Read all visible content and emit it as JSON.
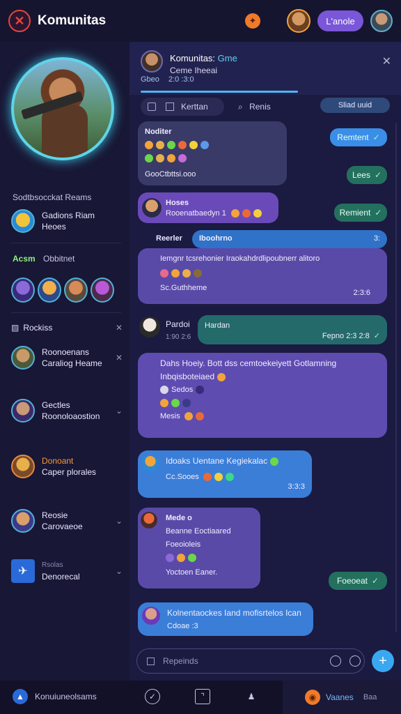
{
  "topbar": {
    "title": "Komunitas",
    "pill_label": "L'anole"
  },
  "sidebar": {
    "section_title": "Sodtbsocckat Reams",
    "group_item": {
      "line1": "Gadions Riam",
      "line2": "Heoes"
    },
    "section2_a": "Acsm",
    "section2_b": "Obbitnet",
    "rockies_label": "Rockiss",
    "items": [
      {
        "line1": "Roonoenans",
        "line2": "Caraliog Heame"
      },
      {
        "line1": "Gectles",
        "line2": "Roonoloaostion"
      },
      {
        "line1": "Donoant",
        "line2": "Caper plorales"
      },
      {
        "line1": "Reosie",
        "line2": "Carovaeoe"
      },
      {
        "line1": "Rsolas",
        "line2": "Denorecal"
      }
    ]
  },
  "chat": {
    "header_title": "Komunitas:",
    "header_title_accent": "Gme",
    "header_sub": "Ceme Iheeai",
    "header_meta": "Gbeo",
    "header_meta2": "2:0 :3:0",
    "tab1": "Kerttan",
    "tab2": "Renis",
    "tab_right": "Sliad  uuid",
    "messages": {
      "m1_head": "Noditer",
      "m1_foot": "GooCtbttsi.ooo",
      "m2_head": "Hoses",
      "m2_body": "Rooenatbaedyn  1",
      "m3_head": "Reerler",
      "m3_title": "Iboohrno",
      "m3_meta": "3:",
      "m3_body": "Iemgnr tcsrehonier Iraokahdrdlipoubnerr alitoro",
      "m3_foot": "Sc.Guthheme",
      "m3_time": "2:3:6",
      "m4_name": "Pardoi",
      "m4_time": "1:90 2:6",
      "m4_pill_head": "Hardan",
      "m4_pill_time": "Fepno 2:3 2:8",
      "m5_line1": "Dahs Hoeiy. Bott dss cemtoekeiyett Gotlamning",
      "m5_line2": "Inbqisboteiaed",
      "m5_line3": "Sedos",
      "m5_line4": "Mesis",
      "m6_line1": "Idoaks Uentane Kegiekalac",
      "m6_line2": "Cc.Sooes",
      "m6_time": "3:3:3",
      "m7_head": "Mede o",
      "m7_line1": "Beanne Eoctiaared",
      "m7_line2": "Foeoioleis",
      "m7_line3": "Yoctoen Eaner.",
      "m8_line1": "Kolnentaockes Iand mofisrtelos Ican",
      "m8_line2": "Cdoae :3"
    },
    "pills": {
      "sent1": "Remtent",
      "sent2": "Lees",
      "sent3": "Remient",
      "sent4": "Foeoeat"
    },
    "composer_placeholder": "Repeinds"
  },
  "bottom_nav": {
    "left_label": "Konuiuneolsams",
    "right_label": "Vaanes",
    "far_right": "Baa"
  }
}
